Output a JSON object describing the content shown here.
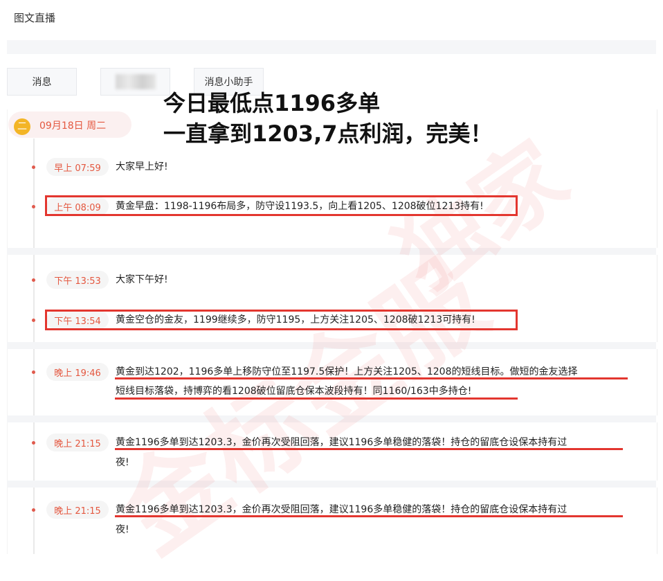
{
  "header": {
    "title": "图文直播"
  },
  "tabs": [
    {
      "label": "消息"
    },
    {
      "label": ""
    },
    {
      "label": "消息小助手"
    }
  ],
  "headline": {
    "line1": "今日最低点1196多单",
    "line2": "一直拿到1203,7点利润，完美！"
  },
  "date": {
    "icon_text": "二",
    "label": "09月18日 周二"
  },
  "messages": [
    {
      "time": "早上 07:59",
      "text": "大家早上好!"
    },
    {
      "time": "上午 08:09",
      "text": "黄金早盘：1198-1196布局多，防守设1193.5，向上看1205、1208破位1213持有!"
    },
    {
      "time": "下午 13:53",
      "text": "大家下午好!"
    },
    {
      "time": "下午 13:54",
      "text": "黄金空仓的金友，1199继续多，防守1195，上方关注1205、1208破1213可持有!"
    },
    {
      "time": "晚上 19:46",
      "line1": "黄金到达1202，1196多单上移防守位至1197.5保护！上方关注1205、1208的短线目标。做短的金友选择",
      "line2": "短线目标落袋，持博弈的看1208破位留底仓保本波段持有！同1160/163中多持仓!"
    },
    {
      "time": "晚上 21:15",
      "line1": "黄金1196多单到达1203.3，金价再次受阻回落，建议1196多单稳健的落袋！持仓的留底仓设保本持有过",
      "line2": "夜!"
    },
    {
      "time": "晚上 21:15",
      "line1": "黄金1196多单到达1203.3，金价再次受阻回落，建议1196多单稳健的落袋！持仓的留底仓设保本持有过",
      "line2": "夜!"
    }
  ],
  "watermark": {
    "text1": "金标金服",
    "text2": "独家"
  },
  "colors": {
    "accent": "#e4573f",
    "highlight": "#e3362f",
    "date_icon": "#f3b526"
  }
}
